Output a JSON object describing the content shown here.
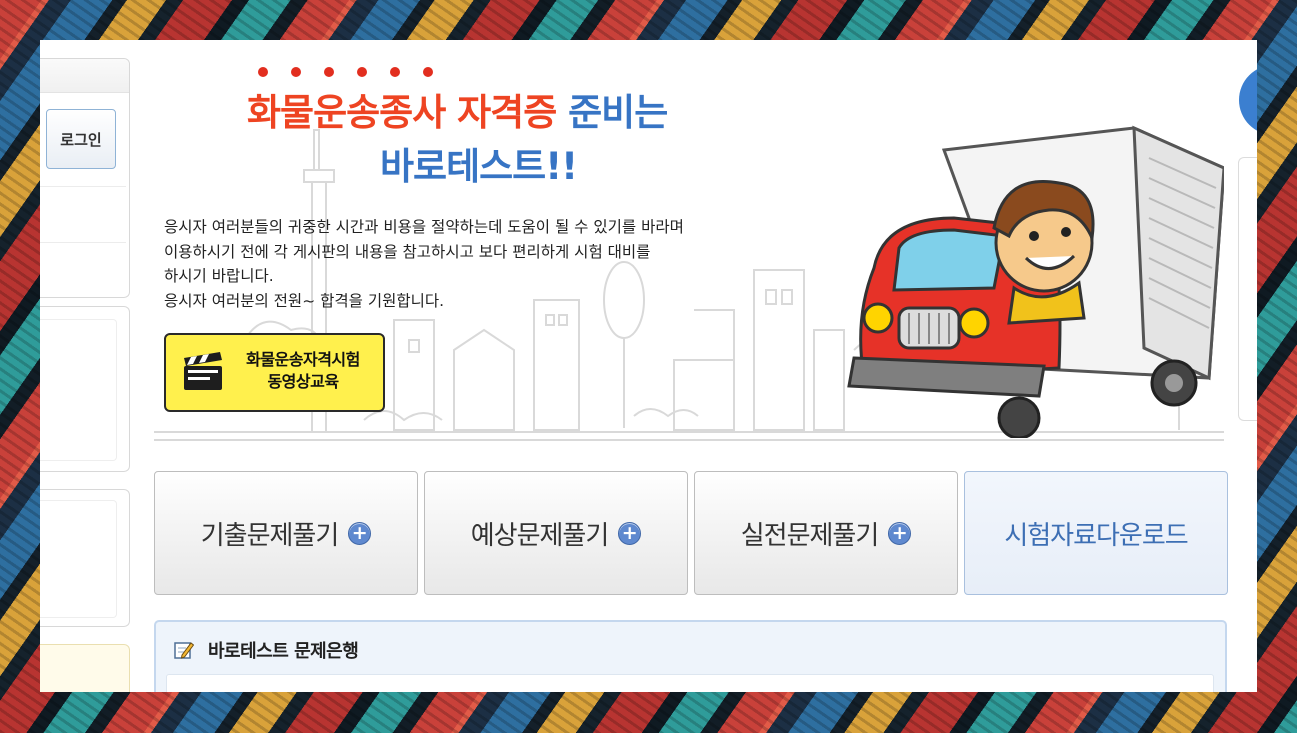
{
  "sidebar": {
    "login_label": "로그인"
  },
  "banner": {
    "headline_red": "화물운송종사 자격증",
    "headline_blue": "준비는",
    "headline_line2": "바로테스트!!",
    "description": [
      "응시자 여러분들의 귀중한 시간과 비용을 절약하는데 도움이 될 수 있기를 바라며",
      "이용하시기  전에 각 게시판의 내용을 참고하시고 보다 편리하게 시험 대비를",
      "하시기 바랍니다.",
      "응시자 여러분의 전원~ 합격을 기원합니다."
    ],
    "video_button": {
      "line1": "화물운송자격시험",
      "line2": "동영상교육",
      "icon": "clapperboard-icon"
    }
  },
  "menu": {
    "buttons": [
      {
        "label": "기출문제풀기",
        "icon": "plus-circle-icon"
      },
      {
        "label": "예상문제풀기",
        "icon": "plus-circle-icon"
      },
      {
        "label": "실전문제풀기",
        "icon": "plus-circle-icon"
      },
      {
        "label": "시험자료다운로드"
      }
    ],
    "plus_symbol": "+"
  },
  "question_bank": {
    "title": "바로테스트 문제은행",
    "icon": "pencil-note-icon"
  },
  "colors": {
    "headline_red": "#ee4422",
    "headline_blue": "#3774c4",
    "video_button_bg": "#fff04d",
    "plus_icon": "#5f89cf"
  }
}
